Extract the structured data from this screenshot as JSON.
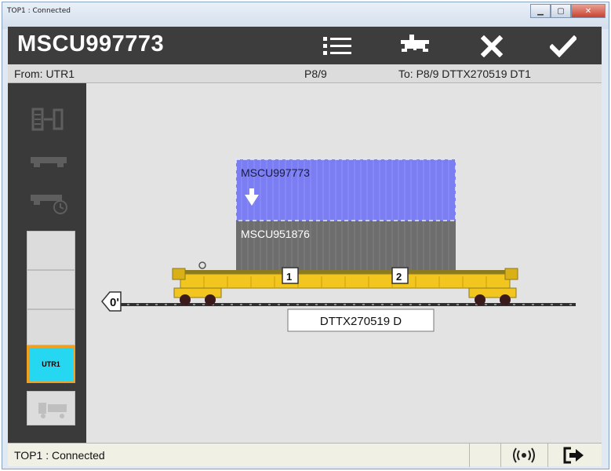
{
  "window": {
    "title": "TOP1 : Connected",
    "minimize": "▁",
    "maximize": "▢",
    "close": "✕"
  },
  "header": {
    "title": "MSCU997773"
  },
  "info": {
    "from": "From: UTR1",
    "position": "P8/9",
    "to": "To: P8/9 DTTX270519 DT1"
  },
  "sidebar": {
    "selected_location": "UTR1"
  },
  "scene": {
    "offset_label": "0'",
    "top_container": "MSCU997773",
    "bottom_container": "MSCU951876",
    "platform_1": "1",
    "platform_2": "2",
    "railcar_label": "DTTX270519 D",
    "colors": {
      "top_container": "#7b7ef2",
      "bottom_container": "#6d6d6d",
      "railcar": "#f2c61e",
      "selected": "#25d7f0"
    }
  },
  "status": {
    "text": "TOP1 : Connected"
  }
}
